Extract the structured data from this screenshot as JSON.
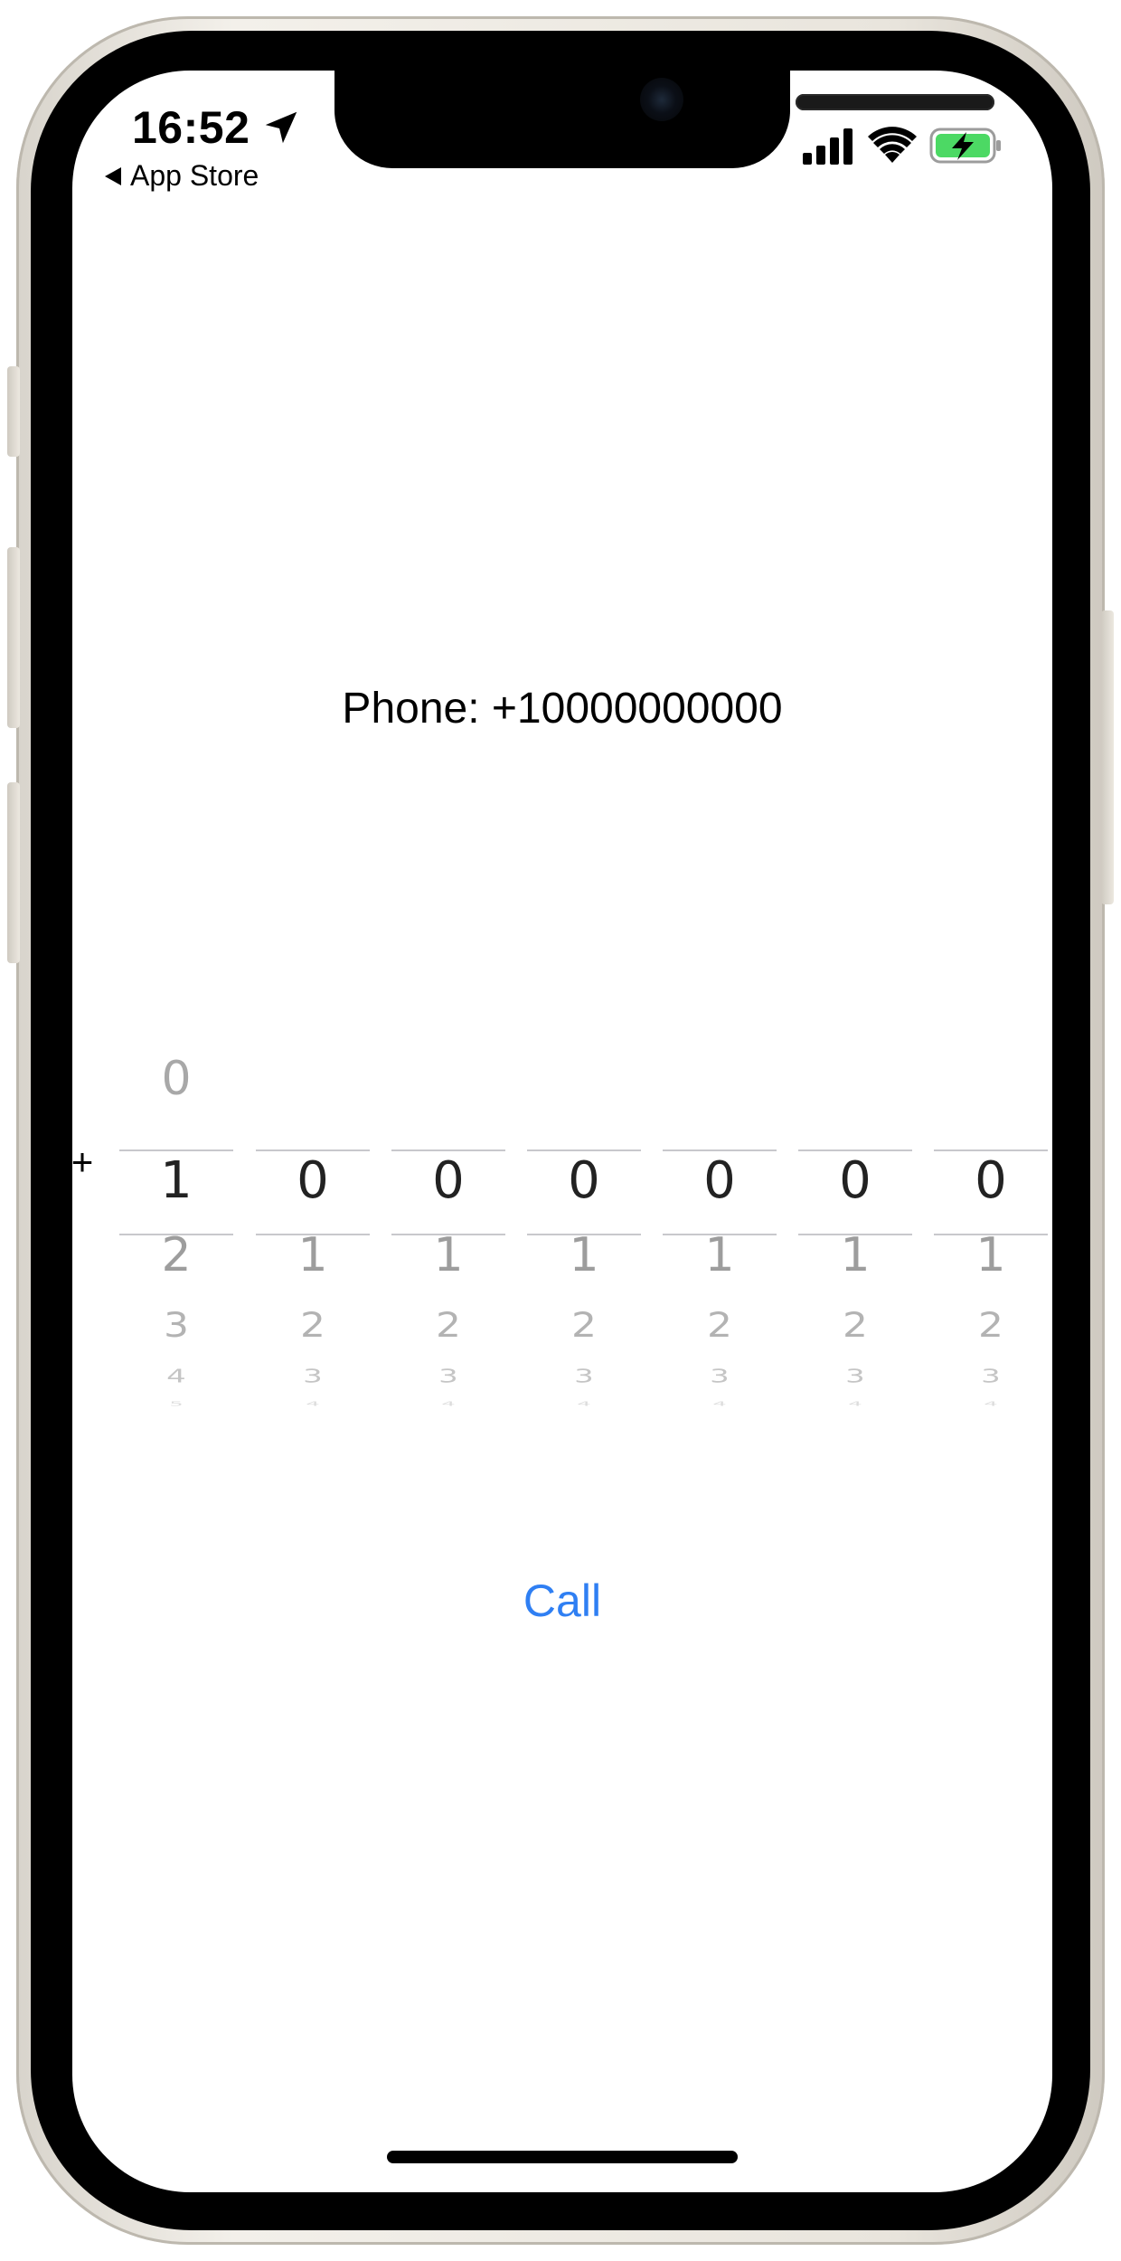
{
  "status_bar": {
    "time": "16:52",
    "back_label": "App Store",
    "icons": [
      "location-arrow-icon",
      "cellular-signal-icon",
      "wifi-icon",
      "battery-charging-icon"
    ],
    "battery_color": "#4cd964"
  },
  "content": {
    "phone_text": "Phone: +10000000000",
    "plus_label": "+",
    "call_label": "Call",
    "accent_color": "#2f7ff3"
  },
  "picker": {
    "wheels": [
      {
        "above": [
          "0"
        ],
        "selected": "1",
        "below": [
          "2",
          "3",
          "4",
          "5"
        ]
      },
      {
        "above": [],
        "selected": "0",
        "below": [
          "1",
          "2",
          "3",
          "4"
        ]
      },
      {
        "above": [],
        "selected": "0",
        "below": [
          "1",
          "2",
          "3",
          "4"
        ]
      },
      {
        "above": [],
        "selected": "0",
        "below": [
          "1",
          "2",
          "3",
          "4"
        ]
      },
      {
        "above": [],
        "selected": "0",
        "below": [
          "1",
          "2",
          "3",
          "4"
        ]
      },
      {
        "above": [],
        "selected": "0",
        "below": [
          "1",
          "2",
          "3",
          "4"
        ]
      },
      {
        "above": [],
        "selected": "0",
        "below": [
          "1",
          "2",
          "3",
          "4"
        ]
      }
    ]
  }
}
